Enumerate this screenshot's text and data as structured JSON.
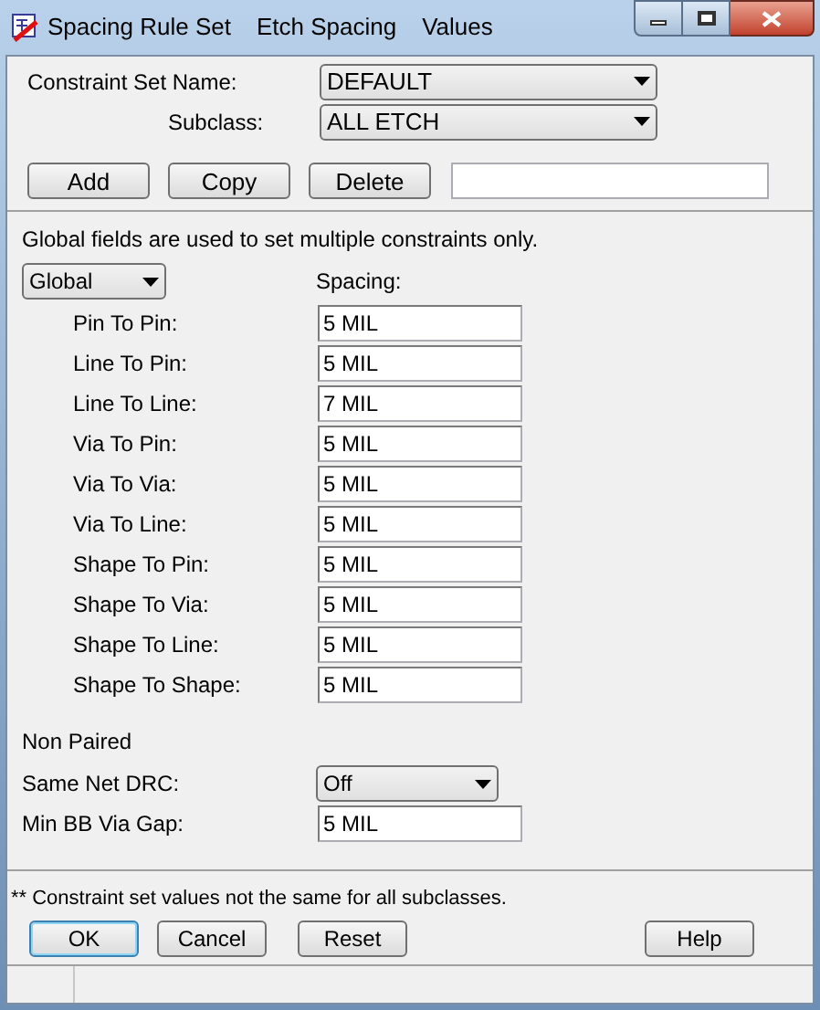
{
  "title_bar": {
    "menus": [
      "Spacing Rule Set",
      "Etch Spacing",
      "Values"
    ]
  },
  "constraint_set": {
    "label": "Constraint Set Name:",
    "value": "DEFAULT"
  },
  "subclass": {
    "label": "Subclass:",
    "value": "ALL ETCH"
  },
  "action_buttons": [
    "Add",
    "Copy",
    "Delete"
  ],
  "note": "Global fields are used to set multiple constraints only.",
  "scope_dropdown": {
    "value": "Global"
  },
  "spacing_heading": "Spacing:",
  "rules": [
    {
      "label": "Pin To Pin:",
      "value": "5 MIL"
    },
    {
      "label": "Line To Pin:",
      "value": "5 MIL"
    },
    {
      "label": "Line To Line:",
      "value": "7 MIL"
    },
    {
      "label": "Via To Pin:",
      "value": "5 MIL"
    },
    {
      "label": "Via To Via:",
      "value": "5 MIL"
    },
    {
      "label": "Via To Line:",
      "value": "5 MIL"
    },
    {
      "label": "Shape To Pin:",
      "value": "5 MIL"
    },
    {
      "label": "Shape To Via:",
      "value": "5 MIL"
    },
    {
      "label": "Shape To Line:",
      "value": "5 MIL"
    },
    {
      "label": "Shape To Shape:",
      "value": "5 MIL"
    }
  ],
  "non_paired": {
    "heading": "Non Paired",
    "same_net_drc": {
      "label": "Same Net DRC:",
      "value": "Off"
    },
    "min_bb_via_gap": {
      "label": "Min BB Via Gap:",
      "value": "5 MIL"
    }
  },
  "footnote": "** Constraint set values not the same for all subclasses.",
  "footer_buttons": [
    {
      "label": "OK",
      "focused": true
    },
    {
      "label": "Cancel",
      "focused": false
    },
    {
      "label": "Reset",
      "focused": false
    },
    {
      "label": "Help",
      "focused": false
    }
  ]
}
